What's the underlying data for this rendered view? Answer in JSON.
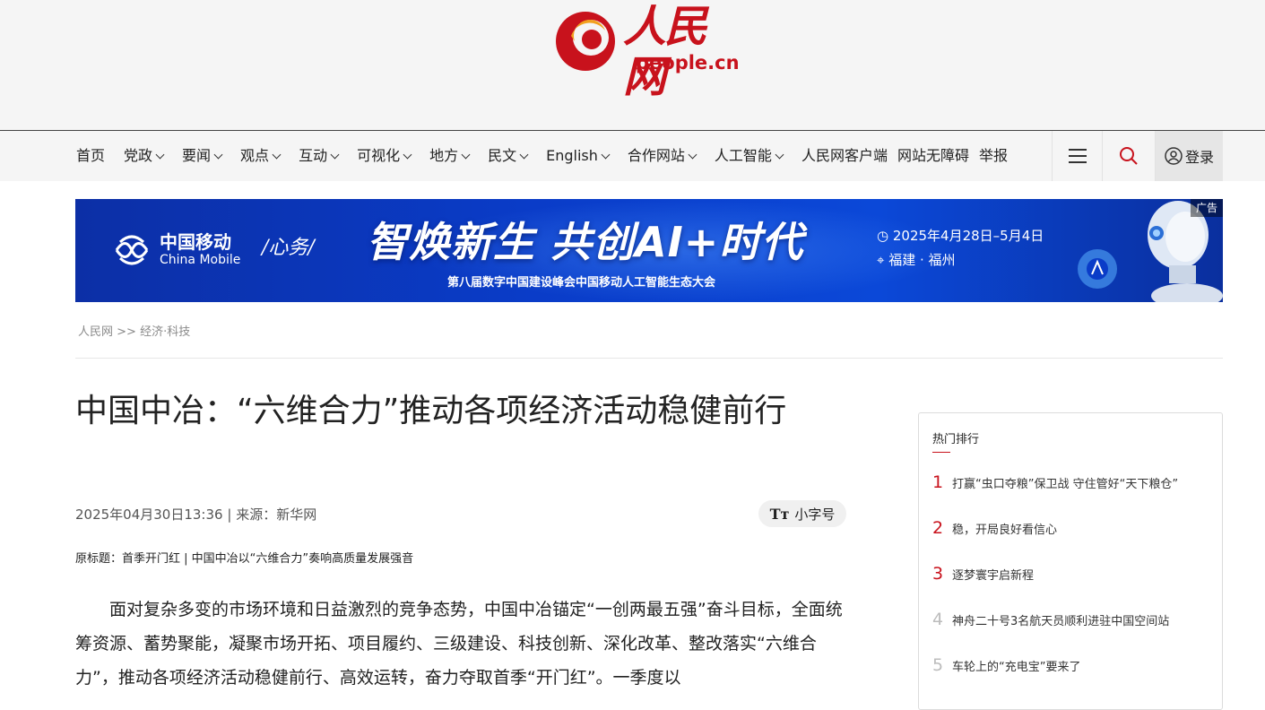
{
  "header": {
    "logo_cn": "人民网",
    "logo_en": "people.cn"
  },
  "nav": {
    "items": [
      {
        "label": "首页",
        "dropdown": false
      },
      {
        "label": "党政",
        "dropdown": true
      },
      {
        "label": "要闻",
        "dropdown": true
      },
      {
        "label": "观点",
        "dropdown": true
      },
      {
        "label": "互动",
        "dropdown": true
      },
      {
        "label": "可视化",
        "dropdown": true
      },
      {
        "label": "地方",
        "dropdown": true
      },
      {
        "label": "民文",
        "dropdown": true
      },
      {
        "label": "English",
        "dropdown": true
      },
      {
        "label": "合作网站",
        "dropdown": true
      },
      {
        "label": "人工智能",
        "dropdown": true
      },
      {
        "label": "人民网客户端",
        "dropdown": false
      },
      {
        "label": "网站无障碍",
        "dropdown": false
      },
      {
        "label": "举报",
        "dropdown": false
      }
    ],
    "login_label": "登录",
    "icons": [
      "menu-icon",
      "search-icon",
      "user-icon"
    ]
  },
  "banner": {
    "brand_cn": "中国移动",
    "brand_en": "China Mobile",
    "brand_sig": "/心务/",
    "headline": "智焕新生 共创AI+时代",
    "subtitle": "第八届数字中国建设峰会中国移动人工智能生态大会",
    "date": "2025年4月28日–5月4日",
    "place": "福建 · 福州",
    "ad_tag": "广告"
  },
  "breadcrumb": {
    "home": "人民网",
    "separator": ">>",
    "section": "经济·科技"
  },
  "article": {
    "title": "中国中冶：“六维合力”推动各项经济活动稳健前行",
    "datetime": "2025年04月30日13:36",
    "source_sep": "|",
    "source_label": "来源：",
    "source": "新华网",
    "font_toggle_label": "小字号",
    "original_title": "原标题：首季开门红 | 中国中冶以“六维合力”奏响高质量发展强音",
    "body": "面对复杂多变的市场环境和日益激烈的竞争态势，中国中冶锚定“一创两最五强”奋斗目标，全面统筹资源、蓄势聚能，凝聚市场开拓、项目履约、三级建设、科技创新、深化改革、整改落实“六维合力”，推动各项经济活动稳健前行、高效运转，奋力夺取首季“开门红”。一季度以"
  },
  "hot_list": {
    "title": "热门排行",
    "items": [
      {
        "rank": "1",
        "text": "打赢“虫口夺粮”保卫战 守住管好“天下粮仓”"
      },
      {
        "rank": "2",
        "text": "稳，开局良好看信心"
      },
      {
        "rank": "3",
        "text": "逐梦寰宇启新程"
      },
      {
        "rank": "4",
        "text": "神舟二十号3名航天员顺利进驻中国空间站"
      },
      {
        "rank": "5",
        "text": "车轮上的“充电宝”要来了"
      }
    ]
  },
  "colors": {
    "brand_red": "#c8121c",
    "banner_blue": "#0a3cc8",
    "nav_bg": "#f5f5f5"
  }
}
